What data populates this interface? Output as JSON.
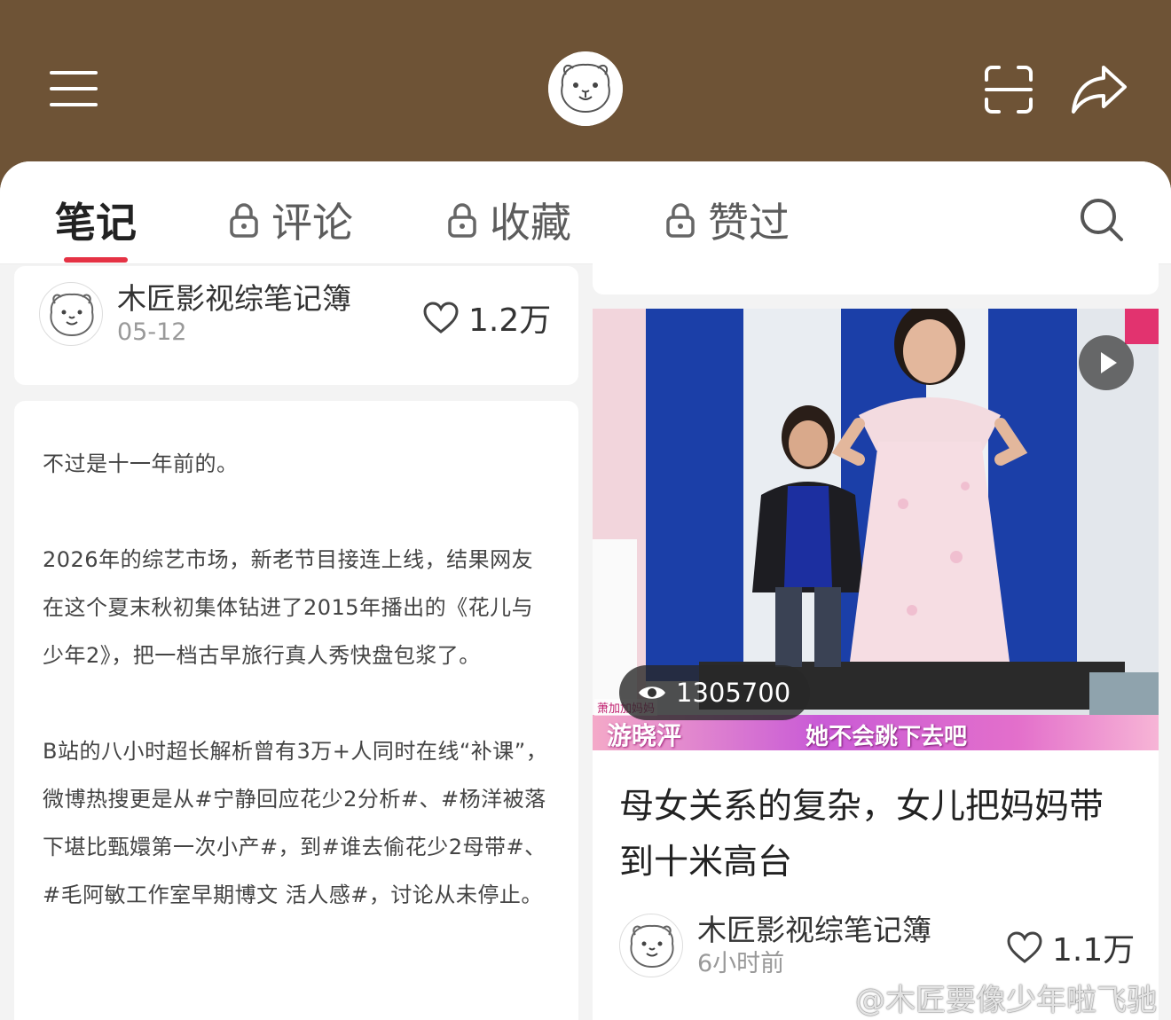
{
  "tabs": [
    {
      "label": "笔记",
      "active": true,
      "locked": false
    },
    {
      "label": "评论",
      "active": false,
      "locked": true
    },
    {
      "label": "收藏",
      "active": false,
      "locked": true
    },
    {
      "label": "赞过",
      "active": false,
      "locked": true
    }
  ],
  "left_card": {
    "author_name": "木匠影视综笔记簿",
    "date": "05-12",
    "likes": "1.2万"
  },
  "post": {
    "paragraphs": [
      "不过是十一年前的。",
      "2026年的综艺市场，新老节目接连上线，结果网友在这个夏末秋初集体钻进了2015年播出的《花儿与少年2》，把一档古早旅行真人秀快盘包浆了。",
      "B站的八小时超长解析曾有3万+人同时在线“补课”，微博热搜更是从#宁静回应花少2分析#、#杨洋被落下堪比甄嬛第一次小产#，到#谁去偷花少2母带#、#毛阿敏工作室早期博文 活人感#，讨论从未停止。"
    ]
  },
  "right_card": {
    "view_count": "1305700",
    "caption_tag": "萧加加妈妈",
    "caption_name": "游晓泙",
    "caption_text": "她不会跳下去吧",
    "title": "母女关系的复杂，女儿把妈妈带到十米高台",
    "author_name": "木匠影视综笔记簿",
    "time": "6小时前",
    "likes": "1.1万"
  },
  "watermark": "@木匠要像少年啦飞驰",
  "colors": {
    "header_bg": "#6e5336",
    "accent": "#e53244"
  },
  "icons": {
    "menu": "menu-icon",
    "scan": "scan-icon",
    "share": "share-icon",
    "search": "search-icon",
    "lock": "lock-icon",
    "heart": "heart-icon",
    "play": "play-icon",
    "eye": "eye-icon",
    "weibo": "weibo-icon"
  }
}
